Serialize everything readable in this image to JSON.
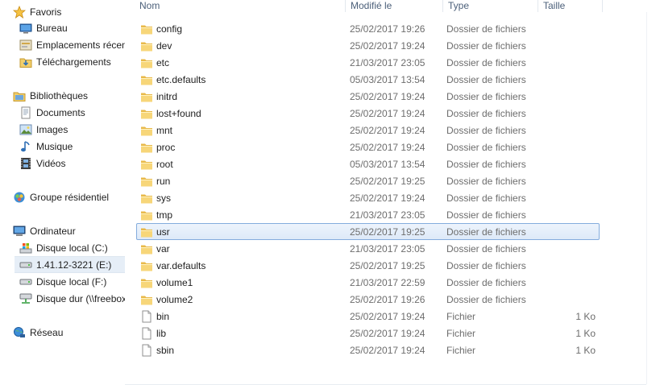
{
  "nav": {
    "favorites": {
      "label": "Favoris",
      "items": [
        "Bureau",
        "Emplacements récents",
        "Téléchargements"
      ]
    },
    "libraries": {
      "label": "Bibliothèques",
      "items": [
        "Documents",
        "Images",
        "Musique",
        "Vidéos"
      ]
    },
    "homegroup": {
      "label": "Groupe résidentiel"
    },
    "computer": {
      "label": "Ordinateur",
      "items": [
        "Disque local (C:)",
        "1.41.12-3221 (E:)",
        "Disque local (F:)",
        "Disque dur (\\\\freebox-server)"
      ]
    },
    "network": {
      "label": "Réseau"
    }
  },
  "columns": {
    "name": "Nom",
    "modified": "Modifié le",
    "type": "Type",
    "size": "Taille"
  },
  "files": [
    {
      "name": "config",
      "modified": "25/02/2017 19:26",
      "type": "Dossier de fichiers",
      "size": "",
      "kind": "folder"
    },
    {
      "name": "dev",
      "modified": "25/02/2017 19:24",
      "type": "Dossier de fichiers",
      "size": "",
      "kind": "folder"
    },
    {
      "name": "etc",
      "modified": "21/03/2017 23:05",
      "type": "Dossier de fichiers",
      "size": "",
      "kind": "folder"
    },
    {
      "name": "etc.defaults",
      "modified": "05/03/2017 13:54",
      "type": "Dossier de fichiers",
      "size": "",
      "kind": "folder"
    },
    {
      "name": "initrd",
      "modified": "25/02/2017 19:24",
      "type": "Dossier de fichiers",
      "size": "",
      "kind": "folder"
    },
    {
      "name": "lost+found",
      "modified": "25/02/2017 19:24",
      "type": "Dossier de fichiers",
      "size": "",
      "kind": "folder"
    },
    {
      "name": "mnt",
      "modified": "25/02/2017 19:24",
      "type": "Dossier de fichiers",
      "size": "",
      "kind": "folder"
    },
    {
      "name": "proc",
      "modified": "25/02/2017 19:24",
      "type": "Dossier de fichiers",
      "size": "",
      "kind": "folder"
    },
    {
      "name": "root",
      "modified": "05/03/2017 13:54",
      "type": "Dossier de fichiers",
      "size": "",
      "kind": "folder"
    },
    {
      "name": "run",
      "modified": "25/02/2017 19:25",
      "type": "Dossier de fichiers",
      "size": "",
      "kind": "folder"
    },
    {
      "name": "sys",
      "modified": "25/02/2017 19:24",
      "type": "Dossier de fichiers",
      "size": "",
      "kind": "folder"
    },
    {
      "name": "tmp",
      "modified": "21/03/2017 23:05",
      "type": "Dossier de fichiers",
      "size": "",
      "kind": "folder"
    },
    {
      "name": "usr",
      "modified": "25/02/2017 19:25",
      "type": "Dossier de fichiers",
      "size": "",
      "kind": "folder",
      "selected": true
    },
    {
      "name": "var",
      "modified": "21/03/2017 23:05",
      "type": "Dossier de fichiers",
      "size": "",
      "kind": "folder"
    },
    {
      "name": "var.defaults",
      "modified": "25/02/2017 19:25",
      "type": "Dossier de fichiers",
      "size": "",
      "kind": "folder"
    },
    {
      "name": "volume1",
      "modified": "21/03/2017 22:59",
      "type": "Dossier de fichiers",
      "size": "",
      "kind": "folder"
    },
    {
      "name": "volume2",
      "modified": "25/02/2017 19:26",
      "type": "Dossier de fichiers",
      "size": "",
      "kind": "folder"
    },
    {
      "name": "bin",
      "modified": "25/02/2017 19:24",
      "type": "Fichier",
      "size": "1 Ko",
      "kind": "file"
    },
    {
      "name": "lib",
      "modified": "25/02/2017 19:24",
      "type": "Fichier",
      "size": "1 Ko",
      "kind": "file"
    },
    {
      "name": "sbin",
      "modified": "25/02/2017 19:24",
      "type": "Fichier",
      "size": "1 Ko",
      "kind": "file"
    }
  ],
  "colors": {
    "selection_border": "#84acdd",
    "selection_bg": "#dde9f8",
    "header_text": "#4c607a",
    "secondary_text": "#6d6d6d"
  }
}
